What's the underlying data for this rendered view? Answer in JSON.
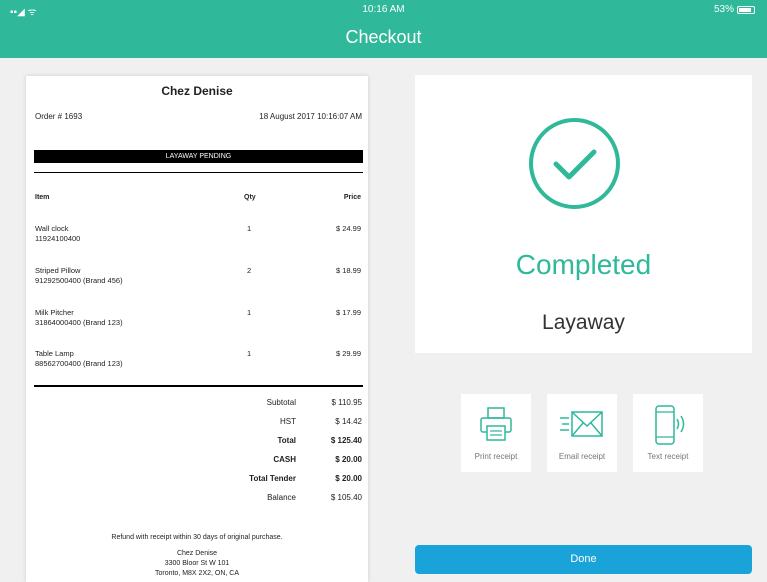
{
  "status": {
    "time": "10:16 AM",
    "battery": "53%"
  },
  "nav": {
    "title": "Checkout"
  },
  "receipt": {
    "store": "Chez Denise",
    "order": "Order # 1693",
    "date": "18 August 2017 10:16:07 AM",
    "pending": "LAYAWAY PENDING",
    "headers": {
      "item": "Item",
      "qty": "Qty",
      "price": "Price"
    },
    "items": [
      {
        "name": "Wall clock",
        "sku": "11924100400",
        "qty": "1",
        "price": "$ 24.99"
      },
      {
        "name": "Striped Pillow",
        "sku": "91292500400 (Brand 456)",
        "qty": "2",
        "price": "$ 18.99"
      },
      {
        "name": "Milk Pitcher",
        "sku": "31864000400 (Brand 123)",
        "qty": "1",
        "price": "$ 17.99"
      },
      {
        "name": "Table Lamp",
        "sku": "88562700400 (Brand 123)",
        "qty": "1",
        "price": "$ 29.99"
      }
    ],
    "totals": [
      {
        "label": "Subtotal",
        "value": "$ 110.95",
        "bold": false
      },
      {
        "label": "HST",
        "value": "$ 14.42",
        "bold": false
      },
      {
        "label": "Total",
        "value": "$ 125.40",
        "bold": true
      },
      {
        "label": "CASH",
        "value": "$ 20.00",
        "bold": true
      },
      {
        "label": "Total Tender",
        "value": "$ 20.00",
        "bold": true
      },
      {
        "label": "Balance",
        "value": "$ 105.40",
        "bold": false
      }
    ],
    "refund_note": "Refund with receipt within 30 days of original purchase.",
    "address": [
      "Chez Denise",
      "3300 Bloor St W 101",
      "Toronto, M8X 2X2, ON, CA"
    ]
  },
  "result": {
    "status": "Completed",
    "type": "Layaway"
  },
  "receipt_options": {
    "print": "Print receipt",
    "email": "Email receipt",
    "text": "Text receipt"
  },
  "done_label": "Done",
  "colors": {
    "accent": "#2fb89a",
    "done": "#1aa3d8"
  }
}
